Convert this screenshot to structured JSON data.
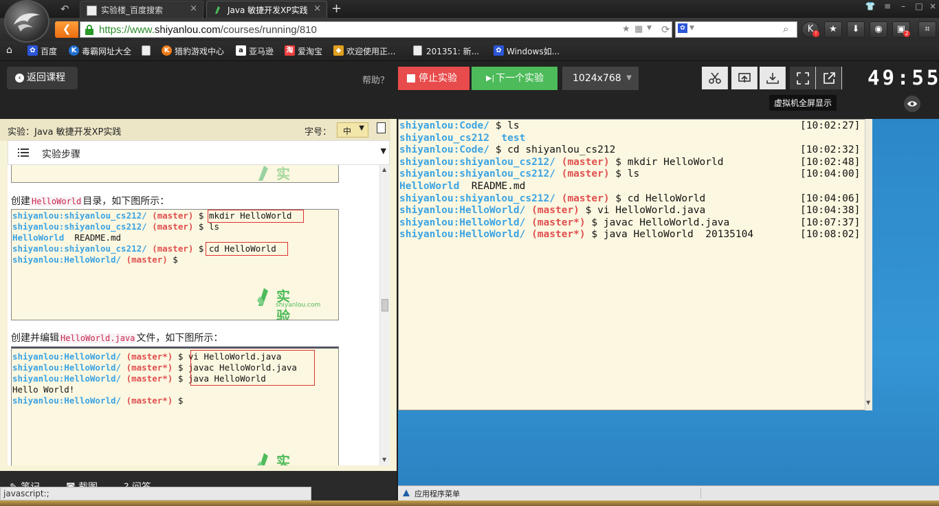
{
  "browser": {
    "tabs": [
      {
        "label": "实验楼_百度搜索",
        "active": false
      },
      {
        "label": "Java 敏捷开发XP实践",
        "active": true
      }
    ],
    "new_tab": "+",
    "url_prefix": "https://www.",
    "url_domain": "shiyanlou.com",
    "url_path": "/courses/running/810",
    "bookmarks": [
      {
        "label": "百度",
        "icon": "baidu-icon"
      },
      {
        "label": "毒霸网址大全",
        "icon": "duba-icon"
      },
      {
        "label": "",
        "icon": "page-icon"
      },
      {
        "label": "猎豹游戏中心",
        "icon": "game-center-icon"
      },
      {
        "label": "亚马逊",
        "icon": "amazon-icon"
      },
      {
        "label": "爱淘宝",
        "icon": "taobao-icon"
      },
      {
        "label": "欢迎使用正...",
        "icon": "cube-icon"
      },
      {
        "label": "201351: 新...",
        "icon": "page-icon"
      },
      {
        "label": "Windows如...",
        "icon": "baidu-paw-icon"
      }
    ],
    "toolbar_badges": {
      "k_badge": "!",
      "tv_badge": "2"
    }
  },
  "site": {
    "return_label": "返回课程",
    "help_label": "帮助？",
    "stop_label": "停止实验",
    "next_label": "下一个实验",
    "resolution": "1024x768",
    "timer": "49:55",
    "tooltip": "虚拟机全屏显示"
  },
  "left_panel": {
    "title": "实验：Java 敏捷开发XP实践",
    "font_label": "字号：",
    "font_value": "中",
    "steps_label": "实验步骤",
    "para1_pre": "创建",
    "para1_code": "HelloWorld",
    "para1_post": "目录，如下图所示：",
    "para2_pre": "创建并编辑",
    "para2_code": "HelloWorld.java",
    "para2_post": "文件，如下图所示：",
    "watermark": "实验楼",
    "watermark_sub": "shiyanlou.com",
    "shot1": [
      {
        "u": "shiyanlou",
        "p": ":shiyanlou_cs212/",
        "b": " (master)",
        "t": " $ mkdir HelloWorld"
      },
      {
        "u": "shiyanlou",
        "p": ":shiyanlou_cs212/",
        "b": " (master)",
        "t": " $ ls"
      },
      {
        "u": "",
        "p": "HelloWorld",
        "b": "",
        "t": "  README.md"
      },
      {
        "u": "shiyanlou",
        "p": ":shiyanlou_cs212/",
        "b": " (master)",
        "t": " $ cd HelloWorld"
      },
      {
        "u": "shiyanlou",
        "p": ":HelloWorld/",
        "b": " (master)",
        "t": " $"
      }
    ],
    "shot2": [
      {
        "u": "shiyanlou",
        "p": ":HelloWorld/",
        "b": " (master*)",
        "t": " $ vi HelloWorld.java"
      },
      {
        "u": "shiyanlou",
        "p": ":HelloWorld/",
        "b": " (master*)",
        "t": " $ javac HelloWorld.java"
      },
      {
        "u": "shiyanlou",
        "p": ":HelloWorld/",
        "b": " (master*)",
        "t": " $ java HelloWorld"
      },
      {
        "u": "",
        "p": "",
        "b": "",
        "t": "Hello World!"
      },
      {
        "u": "shiyanlou",
        "p": ":HelloWorld/",
        "b": " (master*)",
        "t": " $"
      }
    ],
    "bottom_items": [
      "笔记",
      "截图",
      "问答"
    ],
    "status_tip": "javascript:;"
  },
  "vm": {
    "terminal_lines": [
      {
        "u": "shiyanlou",
        "p": ":Code/",
        "b": "",
        "t": " $ ls",
        "ts": "[10:02:27]"
      },
      {
        "u": "",
        "p": "shiyanlou_cs212",
        "b": "",
        "t": "",
        "p2": "  test",
        "ts": ""
      },
      {
        "u": "shiyanlou",
        "p": ":Code/",
        "b": "",
        "t": " $ cd shiyanlou_cs212",
        "ts": "[10:02:32]"
      },
      {
        "u": "shiyanlou",
        "p": ":shiyanlou_cs212/",
        "b": " (master)",
        "t": " $ mkdir HelloWorld",
        "ts": "[10:02:48]"
      },
      {
        "u": "shiyanlou",
        "p": ":shiyanlou_cs212/",
        "b": " (master)",
        "t": " $ ls",
        "ts": "[10:04:00]"
      },
      {
        "u": "",
        "p": "HelloWorld",
        "b": "",
        "t": "  README.md",
        "ts": ""
      },
      {
        "u": "shiyanlou",
        "p": ":shiyanlou_cs212/",
        "b": " (master)",
        "t": " $ cd HelloWorld",
        "ts": "[10:04:06]"
      },
      {
        "u": "shiyanlou",
        "p": ":HelloWorld/",
        "b": " (master)",
        "t": " $ vi HelloWorld.java",
        "ts": "[10:04:38]"
      },
      {
        "u": "shiyanlou",
        "p": ":HelloWorld/",
        "b": " (master*)",
        "t": " $ javac HelloWorld.java",
        "ts": "[10:07:37]"
      },
      {
        "u": "shiyanlou",
        "p": ":HelloWorld/",
        "b": " (master*)",
        "t": " $ java HelloWorld  20135104",
        "ts": "[10:08:02]"
      }
    ],
    "taskbar_label": "应用程序菜单"
  },
  "colors": {
    "accent_green": "#4dbb5a",
    "stop_red": "#e84b4b",
    "prompt_blue": "#3aa3e3",
    "branch_red": "#e05050",
    "terminal_bg": "#fcf7e0"
  }
}
